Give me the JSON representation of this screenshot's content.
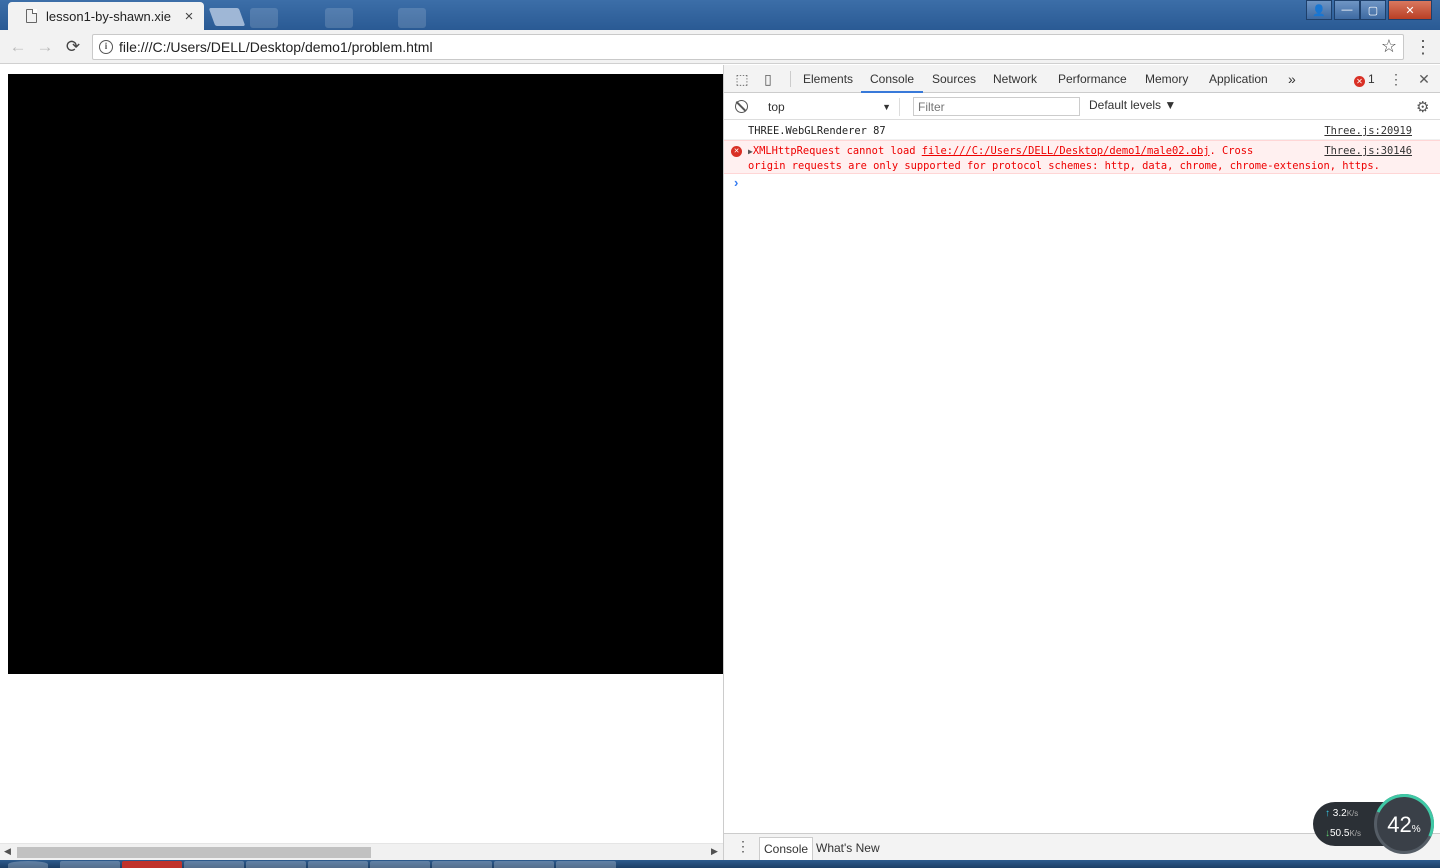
{
  "browser": {
    "tab_title": "lesson1-by-shawn.xie",
    "tab_close": "×",
    "url": "file:///C:/Users/DELL/Desktop/demo1/problem.html",
    "back": "←",
    "forward": "→",
    "reload": "⟳",
    "bookmark_star": "☆",
    "menu": "⋮",
    "window_buttons": {
      "user": "👤",
      "minimize": "—",
      "maximize": "▢",
      "close": "✕"
    }
  },
  "devtools": {
    "tabs": [
      "Elements",
      "Console",
      "Sources",
      "Network",
      "Performance",
      "Memory",
      "Application"
    ],
    "active_tab": "Console",
    "more_tabs": "»",
    "error_count": "1",
    "menu": "⋮",
    "close": "✕",
    "context": "top",
    "filter_placeholder": "Filter",
    "levels": "Default levels ▼",
    "messages": [
      {
        "type": "log",
        "text": "THREE.WebGLRenderer 87",
        "source": "Three.js:20919"
      },
      {
        "type": "error",
        "prefix": "XMLHttpRequest cannot load ",
        "link": "file:///C:/Users/DELL/Desktop/demo1/male02.obj",
        "suffix": ". Cross",
        "line2": "origin requests are only supported for protocol schemes: http, data, chrome, chrome-extension, https.",
        "source": "Three.js:30146"
      }
    ],
    "prompt": "›",
    "drawer": {
      "menu": "⋮",
      "tabs": [
        "Console",
        "What's New"
      ]
    }
  },
  "net_monitor": {
    "upload": "3.2",
    "download": "50.5",
    "unit": "K/s",
    "percent": "42",
    "percent_sign": "%"
  },
  "colors": {
    "accent": "#3879d9",
    "error": "#d93025",
    "canvas": "#000000"
  }
}
